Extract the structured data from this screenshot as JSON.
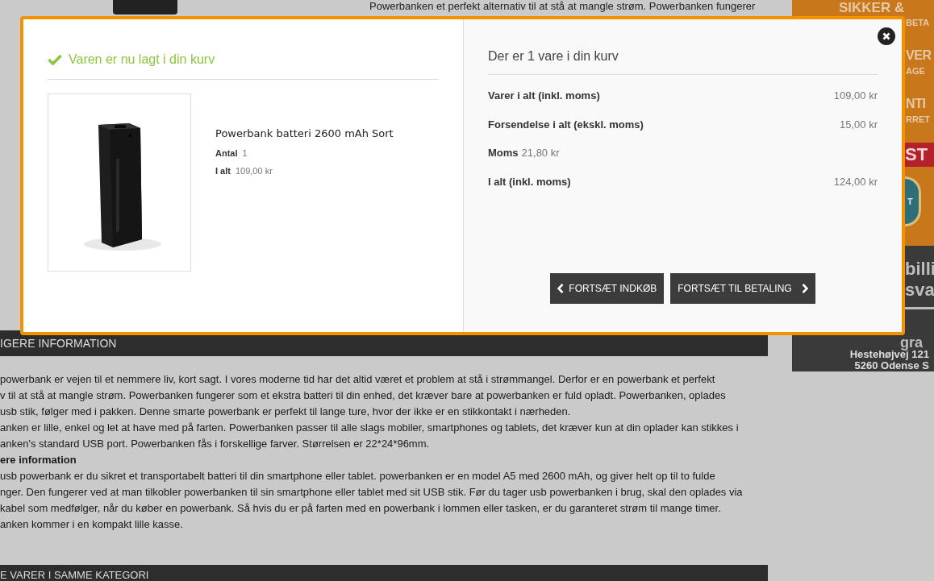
{
  "background": {
    "top_text": "Powerbanken et perfekt alternativ til at stå at mangle strøm. Powerbanken fungerer",
    "section_header": "IGERE INFORMATION",
    "description": [
      {
        "kind": "text",
        "text": "powerbank er vejen til et nemmere liv, kort sagt. I vores moderne tid har det altid været et problem at stå i strømmangel. Derfor er en powerbank et perfekt"
      },
      {
        "kind": "text",
        "text": "v til at stå at mangle strøm. Powerbanken fungerer som et ekstra batteri til din enhed, det kræver bare at powerbanken er fuld opladt. Powerbanken, oplades"
      },
      {
        "kind": "text",
        "text": "usb stik, følger med i pakken. Denne smarte powerbank er perfekt til lange ture, hvor der ikke er en stikkontakt i nærheden."
      },
      {
        "kind": "text",
        "text": "anken er lille, enkel og let at have med på farten. Powerbanken passer til alle slags mobiler, smartphones og tablets, det kræver kun at din oplader kan stikkes i"
      },
      {
        "kind": "text",
        "text": "anken's standard USB port. Powerbanken fås i forskellige farver. Størrelsen er 22*24*96mm."
      },
      {
        "kind": "heading",
        "text": "ere information"
      },
      {
        "kind": "text",
        "text": "usb powerbank er du sikret et transportabelt batteri til din smartphone eller tablet. powerbanken er en model A5 med 2600 mAh, og giver helt op til to fulde"
      },
      {
        "kind": "text",
        "text": "nger. Den fungerer ved at man tilkobler powerbanken til sin smartphone eller tablet med sit USB stik. Før du tager usb powerbanken i brug, skal den oplades via"
      },
      {
        "kind": "text",
        "text": "kabel som medfølger, når du køber en powerbank. Så hvis du er på farten med en powerbank i lommen eller tasken, er du garanteret strøm til mange timer."
      },
      {
        "kind": "text",
        "text": "anken kommer i en kompakt lille kasse."
      }
    ],
    "next_header": "E VARER I SAMME KATEGORI",
    "sidebar": {
      "fragments": [
        {
          "kind": "title",
          "text": "SIKKER &"
        },
        {
          "kind": "sub",
          "text": "BETA"
        },
        {
          "kind": "big",
          "text": "VER"
        },
        {
          "kind": "sub",
          "text": "AGE"
        },
        {
          "kind": "big",
          "text": "NTI"
        },
        {
          "kind": "sub",
          "text": "RRET"
        },
        {
          "kind": "badge",
          "text": "ST"
        },
        {
          "kind": "seal",
          "text": "T"
        }
      ],
      "dark_fragments": [
        "billi",
        "sva"
      ],
      "tagline": "gra",
      "address": [
        "Hestehøjvej 121",
        "5260 Odense S"
      ]
    }
  },
  "modal": {
    "confirmation": "Varen er nu lagt i din kurv",
    "product": {
      "name": "Powerbank batteri 2600 mAh Sort",
      "details": [
        {
          "label": "Antal",
          "value": "1"
        },
        {
          "label": "I alt",
          "value": "109,00 kr"
        }
      ]
    },
    "summary_title": "Der er 1 vare i din kurv",
    "totals": [
      {
        "kind": "split",
        "label": "Varer i alt (inkl. moms)",
        "value": "109,00 kr"
      },
      {
        "kind": "split",
        "label": "Forsendelse i alt (ekskl. moms)",
        "value": "15,00 kr"
      },
      {
        "kind": "inline",
        "label": "Moms",
        "value": "21,80 kr"
      },
      {
        "kind": "split",
        "label": "I alt (inkl. moms)",
        "value": "124,00 kr"
      }
    ],
    "buttons": [
      {
        "kind": "back",
        "label": "FORTSÆT INDKØB"
      },
      {
        "kind": "forward",
        "label": "FORTSÆT TIL BETALING"
      }
    ]
  }
}
